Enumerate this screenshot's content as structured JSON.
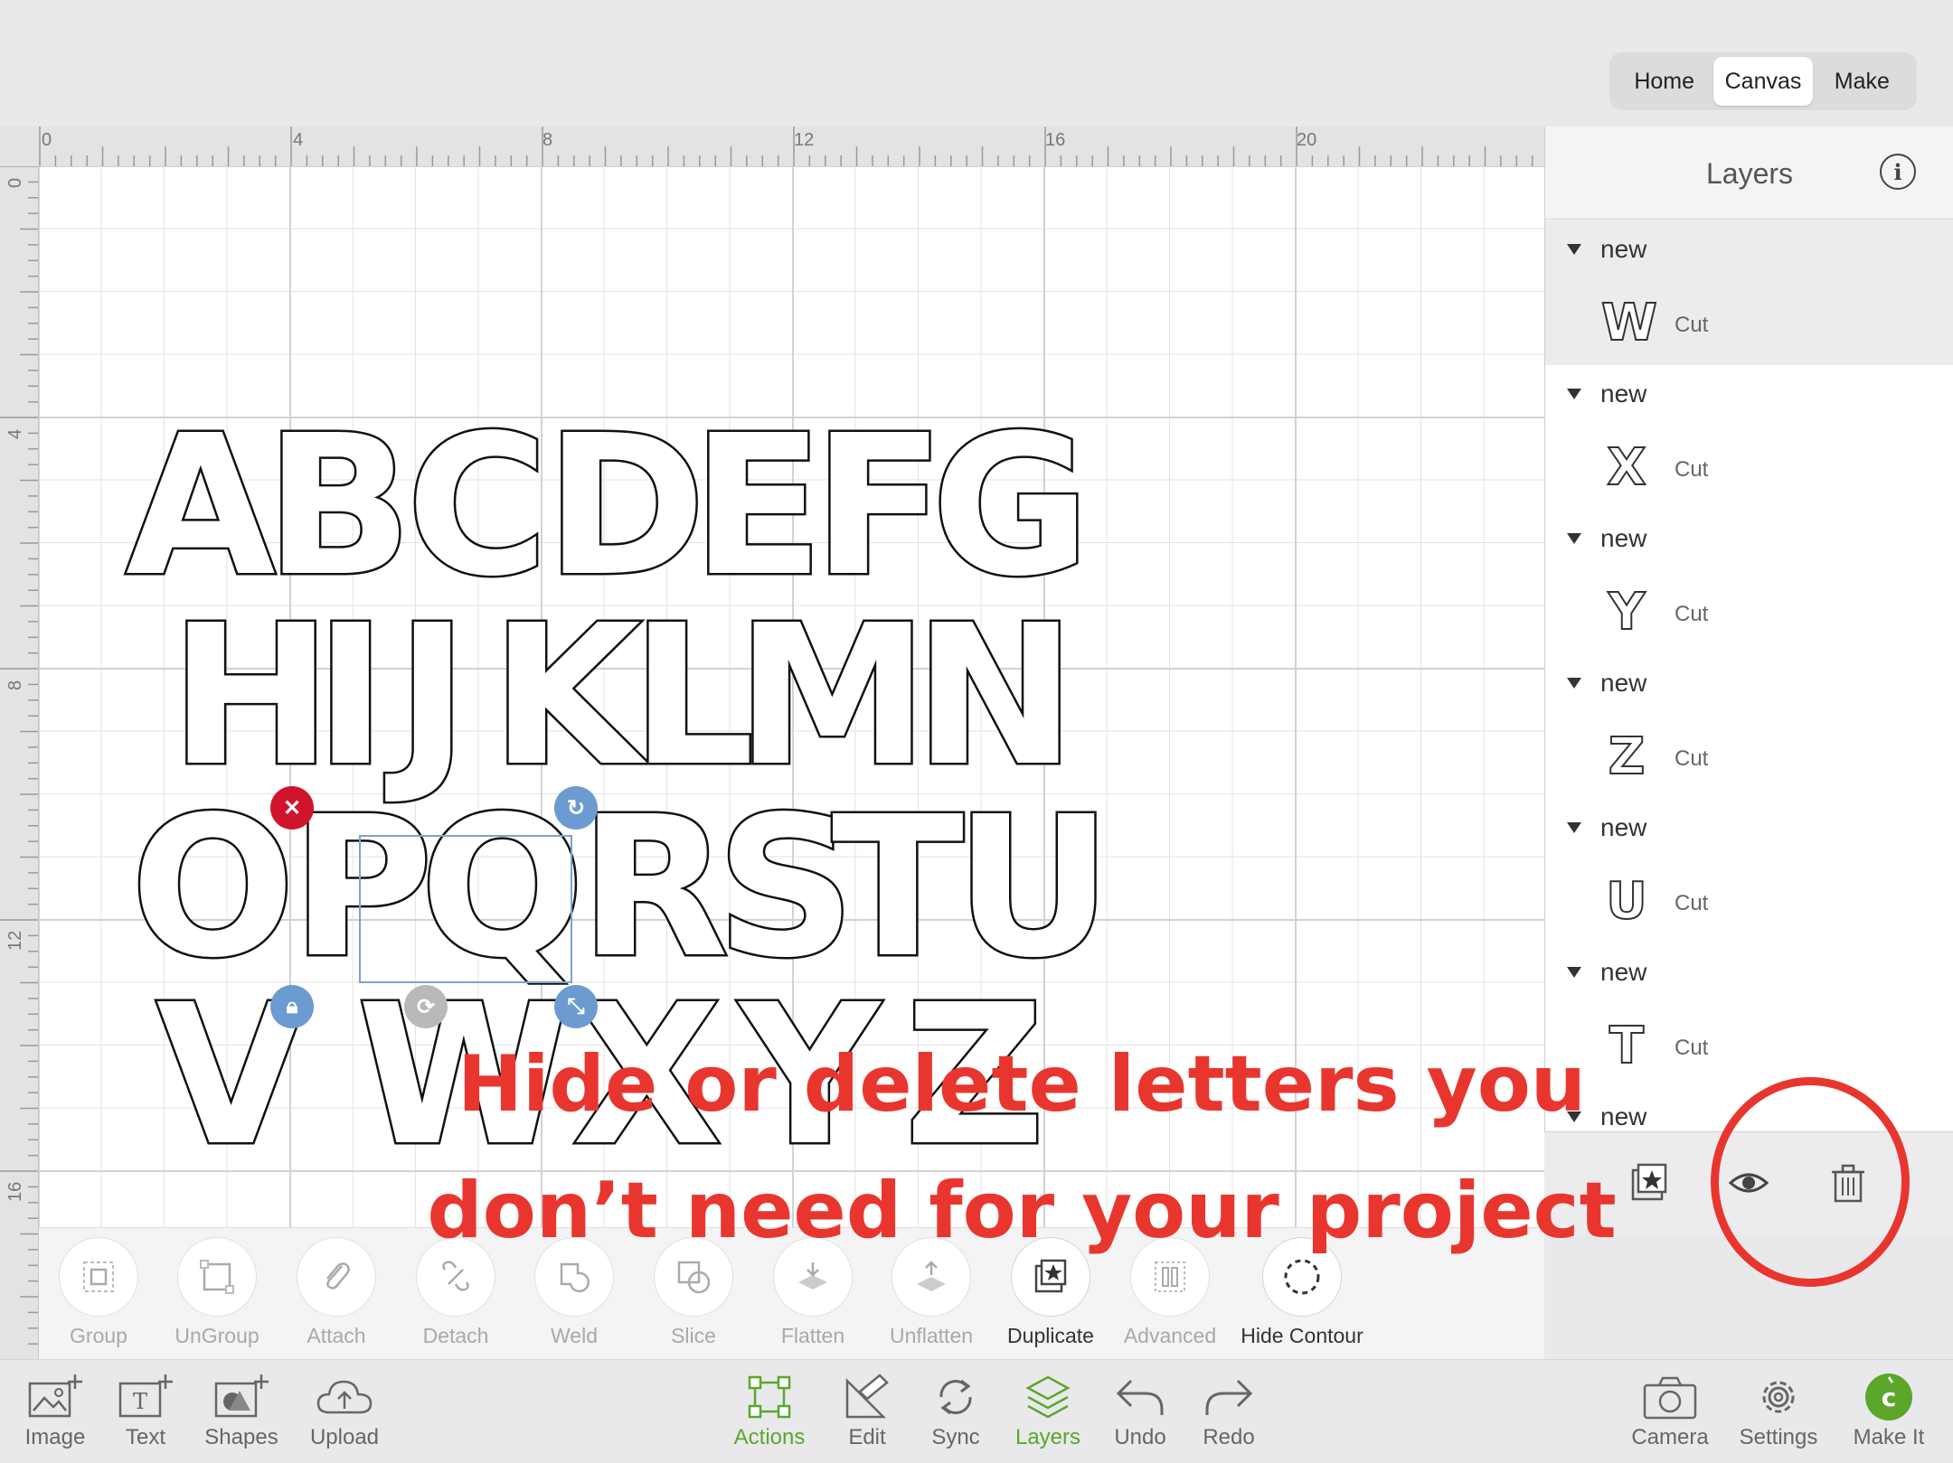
{
  "nav": {
    "home": "Home",
    "canvas": "Canvas",
    "make": "Make"
  },
  "ruler": {
    "top": [
      "0",
      "4",
      "8",
      "12",
      "16",
      "20"
    ],
    "left": [
      "0",
      "4",
      "8",
      "12",
      "16"
    ]
  },
  "canvas_letters": [
    "A",
    "B",
    "C",
    "D",
    "E",
    "F",
    "G",
    "H",
    "I",
    "J",
    "K",
    "L",
    "M",
    "N",
    "O",
    "P",
    "Q",
    "R",
    "S",
    "T",
    "U",
    "V",
    "W",
    "X",
    "Y",
    "Z"
  ],
  "layers": {
    "title": "Layers",
    "groups": [
      {
        "name": "new",
        "letter": "W",
        "type": "Cut"
      },
      {
        "name": "new",
        "letter": "X",
        "type": "Cut"
      },
      {
        "name": "new",
        "letter": "Y",
        "type": "Cut"
      },
      {
        "name": "new",
        "letter": "Z",
        "type": "Cut"
      },
      {
        "name": "new",
        "letter": "U",
        "type": "Cut"
      },
      {
        "name": "new",
        "letter": "T",
        "type": "Cut"
      },
      {
        "name": "new"
      }
    ]
  },
  "actions": [
    "Group",
    "UnGroup",
    "Attach",
    "Detach",
    "Weld",
    "Slice",
    "Flatten",
    "Unflatten",
    "Duplicate",
    "Advanced",
    "Hide Contour"
  ],
  "bottom": {
    "left": [
      "Image",
      "Text",
      "Shapes",
      "Upload"
    ],
    "center": [
      "Actions",
      "Edit",
      "Sync",
      "Layers",
      "Undo",
      "Redo"
    ],
    "right": [
      "Camera",
      "Settings",
      "Make It"
    ]
  },
  "annotation": {
    "line1": "Hide or delete letters you",
    "line2": "don’t need for your project"
  },
  "colors": {
    "accent_green": "#5aa72a",
    "annotation_red": "#e8362f",
    "handle_blue": "#6b9bd1",
    "delete_red": "#d0142c"
  }
}
